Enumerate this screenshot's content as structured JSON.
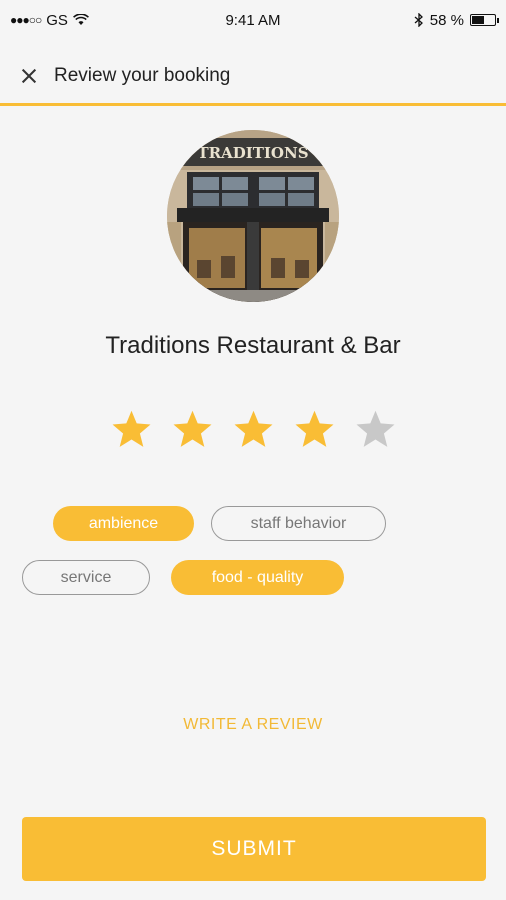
{
  "status_bar": {
    "carrier": "GS",
    "time": "9:41 AM",
    "battery_text": "58 %",
    "battery_level": 0.58
  },
  "header": {
    "title": "Review your booking"
  },
  "restaurant": {
    "name": "Traditions Restaurant & Bar",
    "sign_text": "TRADITIONS"
  },
  "rating": {
    "value": 4,
    "max": 5
  },
  "tags": [
    {
      "label": "ambience",
      "selected": true
    },
    {
      "label": "staff behavior",
      "selected": false
    },
    {
      "label": "service",
      "selected": false
    },
    {
      "label": "food - quality",
      "selected": true
    }
  ],
  "write_review_label": "WRITE A REVIEW",
  "submit_label": "SUBMIT",
  "colors": {
    "accent": "#f9bd35",
    "star_empty": "#c8c8c8"
  }
}
